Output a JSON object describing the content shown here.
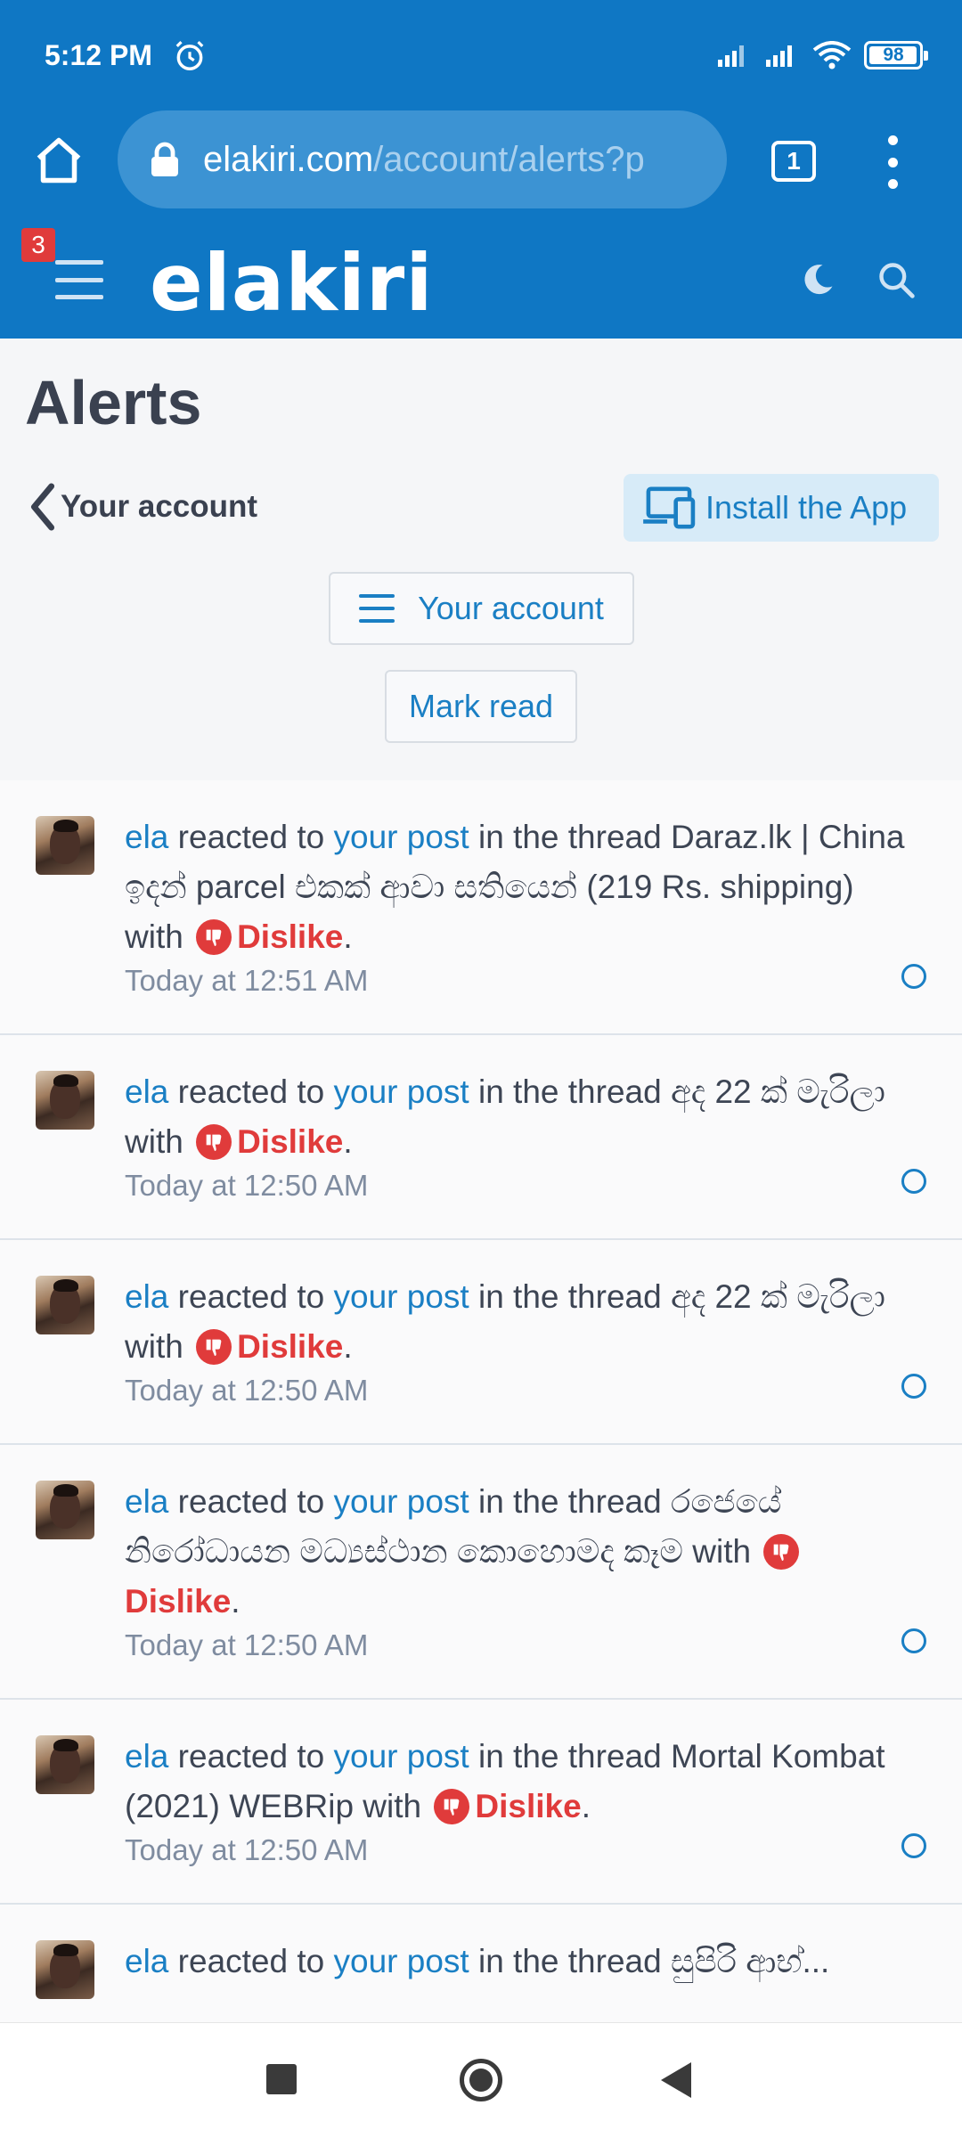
{
  "status_bar": {
    "time": "5:12 PM",
    "battery": "98",
    "battery_level": 0.98
  },
  "browser": {
    "url_host": "elakiri.com",
    "url_path": "/account/alerts?p",
    "tab_count": "1"
  },
  "site_header": {
    "logo": "elakiri",
    "notification_count": "3"
  },
  "page": {
    "title": "Alerts",
    "back_label": "Your account",
    "install_label": "Install the App",
    "account_menu_label": "Your account",
    "mark_read_label": "Mark read"
  },
  "alert_strings": {
    "reacted_to": " reacted to ",
    "in_the_thread": " in the thread ",
    "with": " with ",
    "period": "."
  },
  "alerts": [
    {
      "user": "ela",
      "target": "your post",
      "thread": "Daraz.lk | China ඉදන් parcel එකක් ආවා සතියෙන් (219 Rs. shipping)",
      "reaction": "Dislike",
      "time": "Today at 12:51 AM"
    },
    {
      "user": "ela",
      "target": "your post",
      "thread": "අද 22 ක් මැරිලා",
      "reaction": "Dislike",
      "time": "Today at 12:50 AM"
    },
    {
      "user": "ela",
      "target": "your post",
      "thread": "අද 22 ක් මැරිලා",
      "reaction": "Dislike",
      "time": "Today at 12:50 AM"
    },
    {
      "user": "ela",
      "target": "your post",
      "thread": "රජෙයේ නිරෝධායන මධ්‍යස්ථාන කොහොමද කෑම",
      "reaction": "Dislike",
      "time": "Today at 12:50 AM"
    },
    {
      "user": "ela",
      "target": "your post",
      "thread": "Mortal Kombat (2021) WEBRip",
      "reaction": "Dislike",
      "time": "Today at 12:50 AM"
    },
    {
      "user": "ela",
      "target": "your post",
      "thread": "සුපිරි ආභ්...",
      "reaction": "",
      "time": ""
    }
  ],
  "colors": {
    "brand": "#0f77c4",
    "link": "#1a7fc4",
    "dislike": "#e03b3b"
  }
}
